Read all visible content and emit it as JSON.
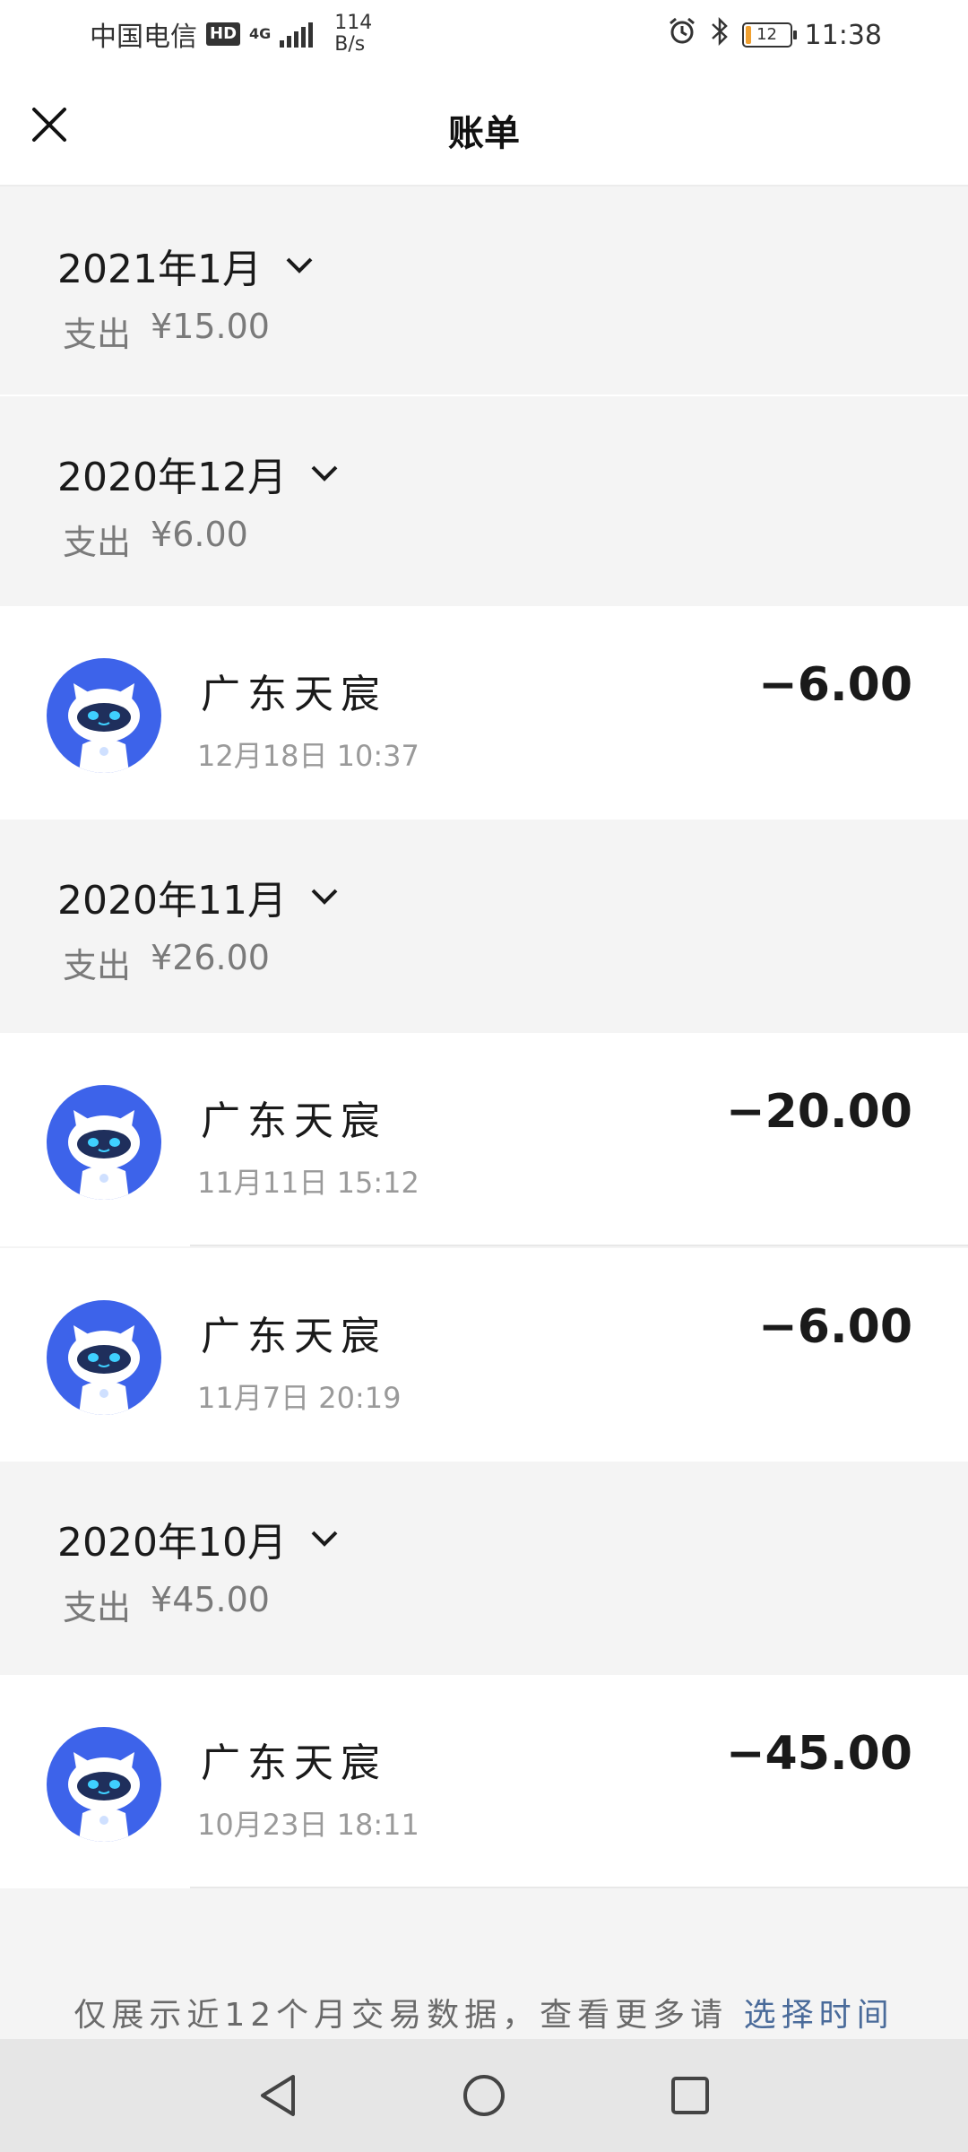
{
  "status_bar": {
    "carrier": "中国电信",
    "hd": "HD",
    "network": "4G",
    "speed_value": "114",
    "speed_unit": "B/s",
    "battery": "12",
    "time": "11:38"
  },
  "header": {
    "title": "账单"
  },
  "months": [
    {
      "label": "2021年1月",
      "expense_label": "支出",
      "expense_value": "¥15.00"
    },
    {
      "label": "2020年12月",
      "expense_label": "支出",
      "expense_value": "¥6.00"
    },
    {
      "label": "2020年11月",
      "expense_label": "支出",
      "expense_value": "¥26.00"
    },
    {
      "label": "2020年10月",
      "expense_label": "支出",
      "expense_value": "¥45.00"
    }
  ],
  "transactions": [
    {
      "merchant": "广东天宸",
      "time": "12月18日  10:37",
      "amount": "−6.00"
    },
    {
      "merchant": "广东天宸",
      "time": "11月11日  15:12",
      "amount": "−20.00"
    },
    {
      "merchant": "广东天宸",
      "time": "11月7日  20:19",
      "amount": "−6.00"
    },
    {
      "merchant": "广东天宸",
      "time": "10月23日  18:11",
      "amount": "−45.00"
    }
  ],
  "footer": {
    "note": "仅展示近12个月交易数据，查看更多请",
    "link": "选择时间"
  },
  "colors": {
    "avatar_bg": "#3d63ea",
    "link": "#4a6b9a",
    "battery": "#f0a030"
  }
}
